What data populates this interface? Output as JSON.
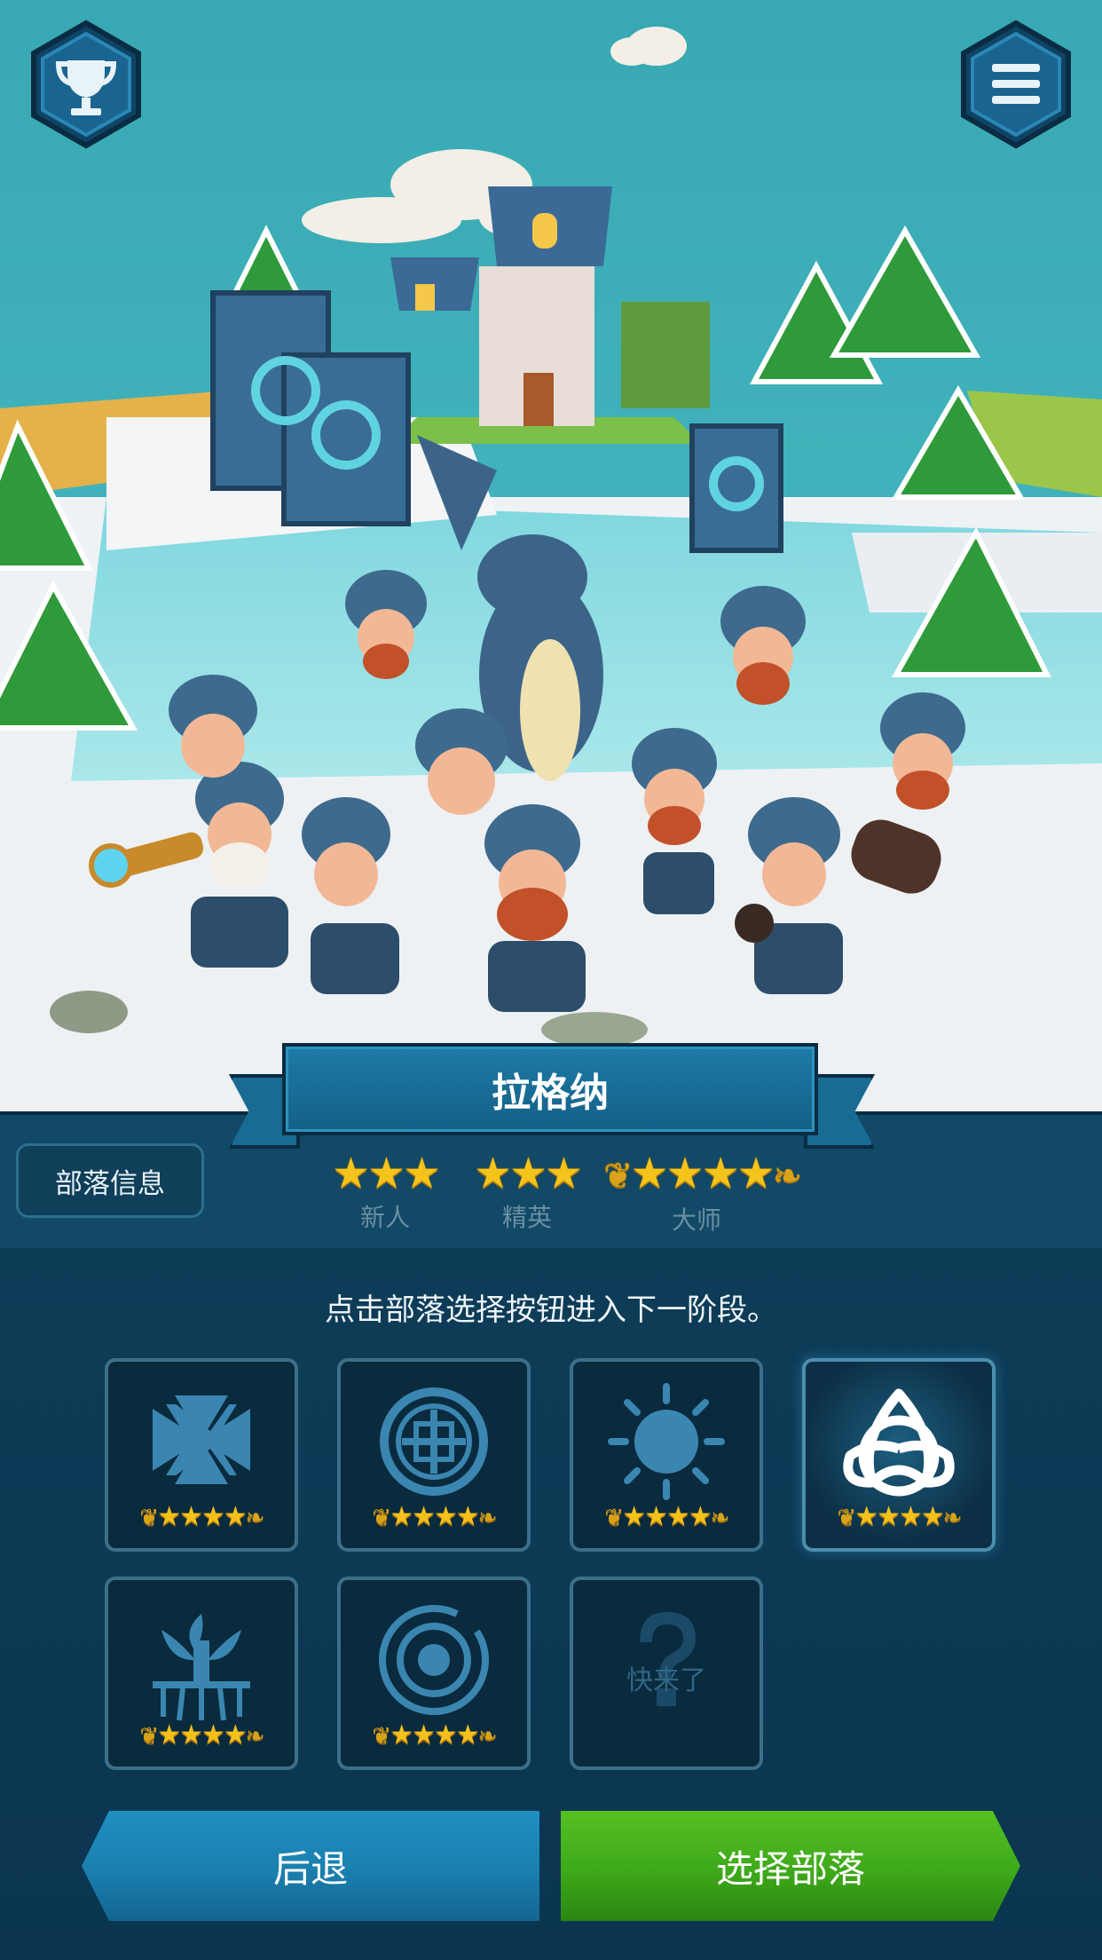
{
  "header": {
    "trophy_icon": "trophy-icon",
    "menu_icon": "hamburger-menu-icon"
  },
  "tribe": {
    "name": "拉格纳"
  },
  "info": {
    "tribe_info_label": "部落信息",
    "ranks": [
      {
        "label": "新人",
        "stars": "★★★"
      },
      {
        "label": "精英",
        "stars": "★★★"
      },
      {
        "label": "大师",
        "stars": "★★★★"
      }
    ]
  },
  "selection": {
    "instruction": "点击部落选择按钮进入下一阶段。",
    "tiles": [
      {
        "emblem": "iron-cross-icon",
        "stars": "★★★★"
      },
      {
        "emblem": "knot-circle-icon",
        "stars": "★★★★"
      },
      {
        "emblem": "sun-icon",
        "stars": "★★★★"
      },
      {
        "emblem": "triquetra-icon",
        "stars": "★★★★",
        "selected": true
      },
      {
        "emblem": "tree-roots-icon",
        "stars": "★★★★"
      },
      {
        "emblem": "concentric-rings-icon",
        "stars": "★★★★"
      },
      {
        "emblem": "question-mark-icon",
        "label": "快来了",
        "locked": true
      }
    ]
  },
  "buttons": {
    "back_label": "后退",
    "choose_label": "选择部落"
  },
  "colors": {
    "sky": "#3ab0ba",
    "panel": "#0d3a55",
    "banner": "#1a6f99",
    "star_gold": "#f5c41c",
    "back_button": "#1a7fae",
    "choose_button": "#3ea91a"
  }
}
